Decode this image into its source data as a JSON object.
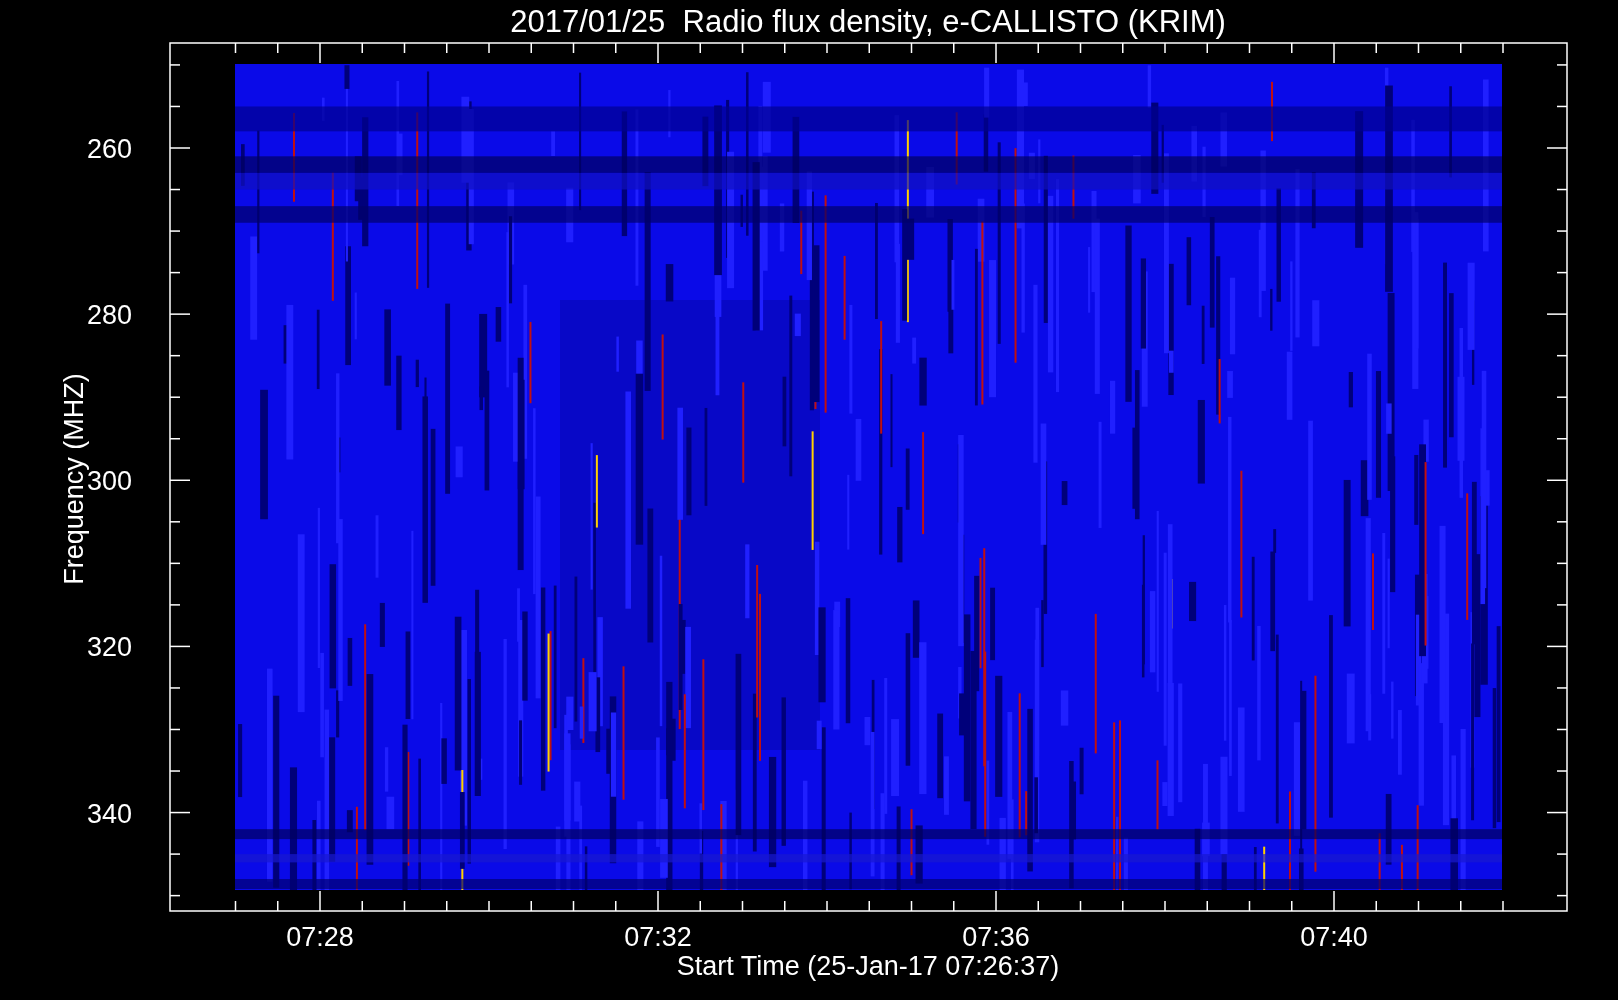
{
  "title": "2017/01/25  Radio flux density, e-CALLISTO (KRIM)",
  "y_axis": {
    "label": "Frequency (MHZ)",
    "ticks": [
      "260",
      "280",
      "300",
      "320",
      "340"
    ]
  },
  "x_axis": {
    "label": "Start Time (25-Jan-17 07:26:37)",
    "ticks": [
      "07:28",
      "07:32",
      "07:36",
      "07:40"
    ]
  }
}
